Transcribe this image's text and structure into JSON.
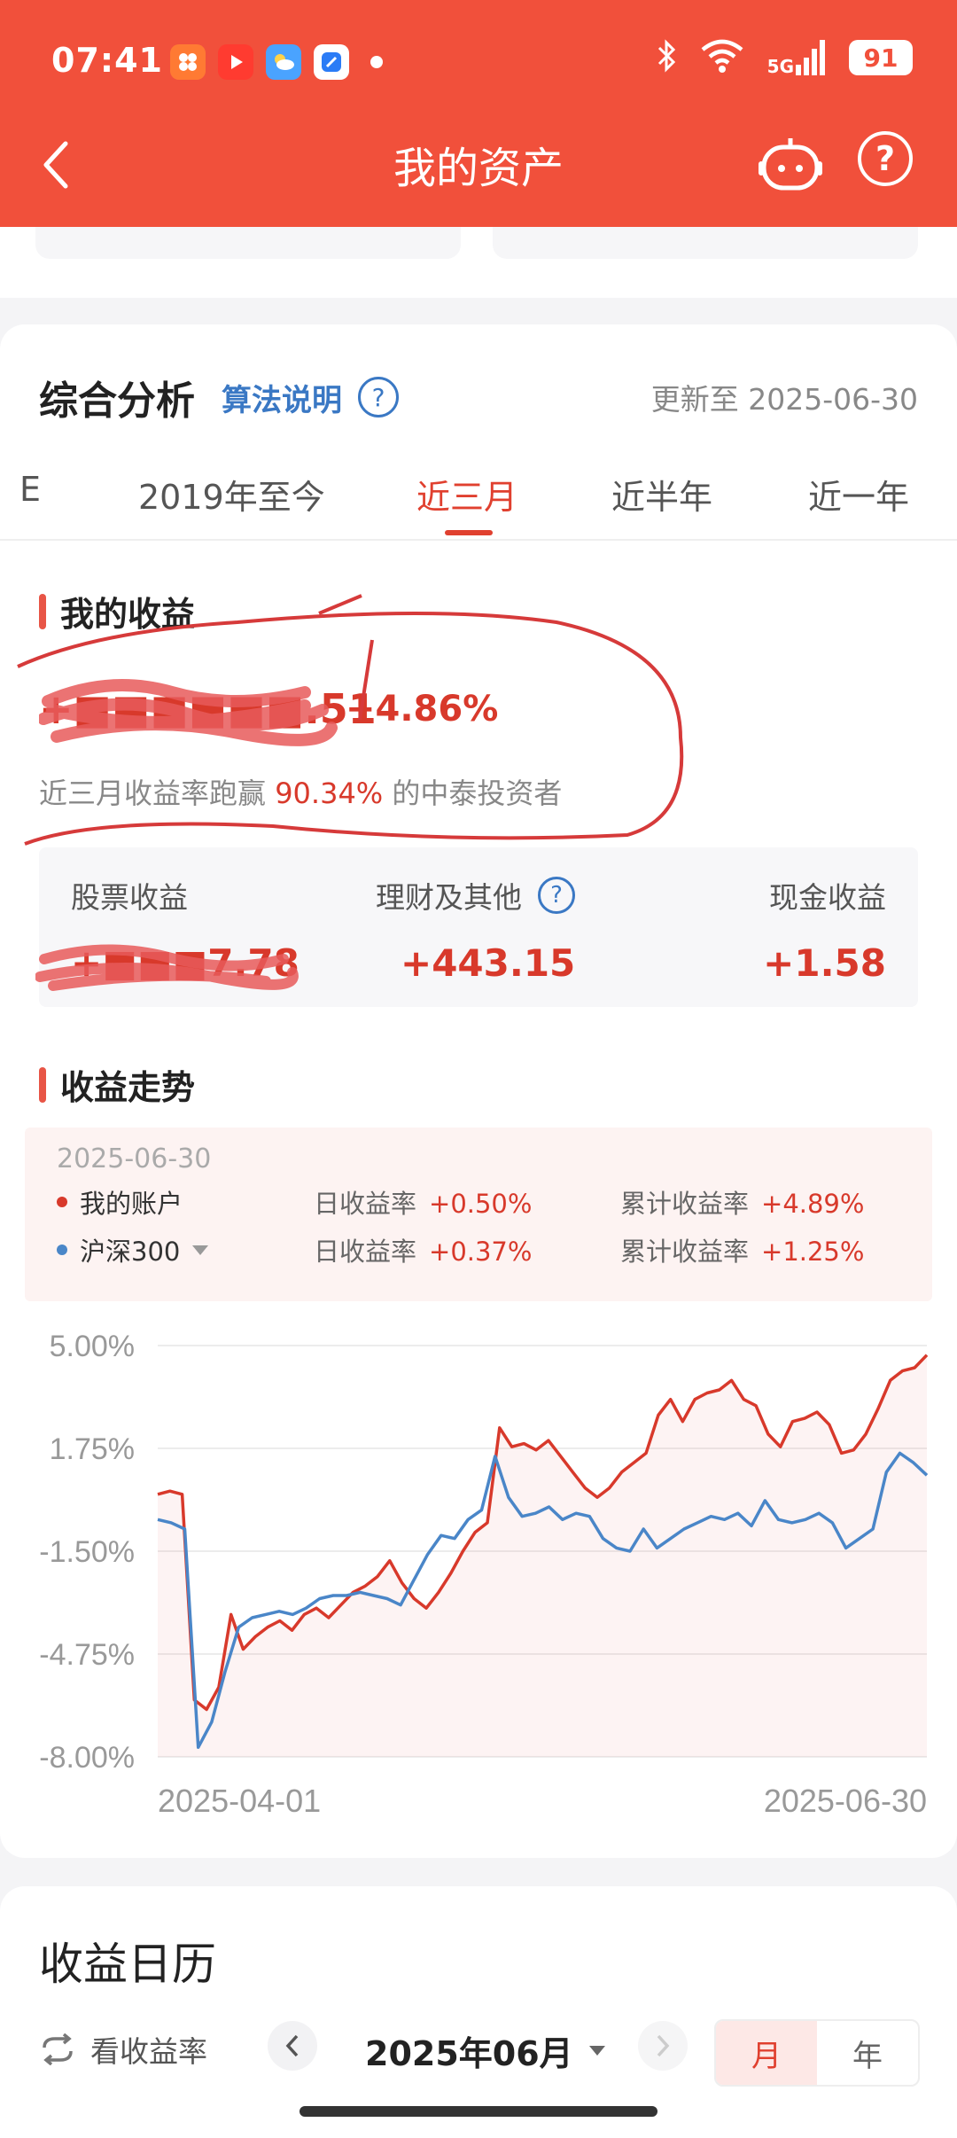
{
  "status_bar": {
    "time": "07:41",
    "network": "5G",
    "battery": "91"
  },
  "nav": {
    "title": "我的资产"
  },
  "analysis": {
    "title": "综合分析",
    "algo_link": "算法说明",
    "update_text": "更新至 2025-06-30",
    "tabs": [
      {
        "label": "E"
      },
      {
        "label": "2019年至今"
      },
      {
        "label": "近三月"
      },
      {
        "label": "近半年"
      },
      {
        "label": "近一年"
      }
    ],
    "active_tab": "近三月"
  },
  "my_earnings": {
    "title": "我的收益",
    "amount_masked": "+■■■■■■.51",
    "rate": "+4.86%",
    "beat_prefix": "近三月收益率跑赢",
    "beat_percent": "90.34%",
    "beat_suffix": "的中泰投资者"
  },
  "breakdown": {
    "stock_label": "股票收益",
    "stock_value_masked": "+■■■7.78",
    "wealth_label": "理财及其他",
    "wealth_value": "+443.15",
    "cash_label": "现金收益",
    "cash_value": "+1.58"
  },
  "trend": {
    "title": "收益走势",
    "date": "2025-06-30",
    "rows": [
      {
        "name": "我的账户",
        "daily_label": "日收益率",
        "daily": "+0.50%",
        "cum_label": "累计收益率",
        "cum": "+4.89%",
        "color": "#d8392b"
      },
      {
        "name": "沪深300",
        "daily_label": "日收益率",
        "daily": "+0.37%",
        "cum_label": "累计收益率",
        "cum": "+1.25%",
        "color": "#4a86c8"
      }
    ]
  },
  "chart_data": {
    "type": "line",
    "x_start": "2025-04-01",
    "x_end": "2025-06-30",
    "yticks": [
      "5.00%",
      "1.75%",
      "-1.50%",
      "-4.75%",
      "-8.00%"
    ],
    "ylim": [
      -8.0,
      5.0
    ],
    "series": [
      {
        "name": "我的账户",
        "color": "#d8392b",
        "values": [
          0.3,
          0.4,
          0.3,
          -6.2,
          -6.5,
          -5.8,
          -3.5,
          -4.6,
          -4.2,
          -3.9,
          -3.7,
          -4.0,
          -3.5,
          -3.3,
          -3.6,
          -3.2,
          -2.8,
          -2.6,
          -2.3,
          -1.8,
          -2.5,
          -3.0,
          -3.3,
          -2.8,
          -2.2,
          -1.5,
          -0.9,
          -0.6,
          2.4,
          1.8,
          1.9,
          1.7,
          2.0,
          1.5,
          1.0,
          0.5,
          0.2,
          0.5,
          1.0,
          1.3,
          1.6,
          2.8,
          3.3,
          2.6,
          3.3,
          3.5,
          3.6,
          3.9,
          3.3,
          3.1,
          2.2,
          1.8,
          2.6,
          2.7,
          2.9,
          2.5,
          1.6,
          1.7,
          2.2,
          3.0,
          3.9,
          4.2,
          4.3,
          4.7
        ]
      },
      {
        "name": "沪深300",
        "color": "#4a86c8",
        "values": [
          -0.5,
          -0.6,
          -0.8,
          -7.7,
          -6.9,
          -5.3,
          -3.9,
          -3.6,
          -3.5,
          -3.4,
          -3.5,
          -3.3,
          -3.0,
          -2.9,
          -2.9,
          -2.8,
          -2.9,
          -3.0,
          -3.2,
          -2.4,
          -1.6,
          -1.0,
          -1.1,
          -0.5,
          -0.2,
          1.5,
          0.2,
          -0.4,
          -0.3,
          -0.1,
          -0.5,
          -0.3,
          -0.4,
          -1.1,
          -1.4,
          -1.5,
          -0.8,
          -1.4,
          -1.1,
          -0.8,
          -0.6,
          -0.4,
          -0.5,
          -0.3,
          -0.7,
          0.1,
          -0.5,
          -0.6,
          -0.5,
          -0.3,
          -0.6,
          -1.4,
          -1.1,
          -0.8,
          1.0,
          1.6,
          1.3,
          0.9
        ]
      }
    ]
  },
  "calendar": {
    "title": "收益日历",
    "toggle_label": "看收益率",
    "month": "2025年06月",
    "seg_month": "月",
    "seg_year": "年"
  },
  "colors": {
    "header": "#f1503b",
    "accent_red": "#d8392b",
    "link_blue": "#3a78c4"
  }
}
